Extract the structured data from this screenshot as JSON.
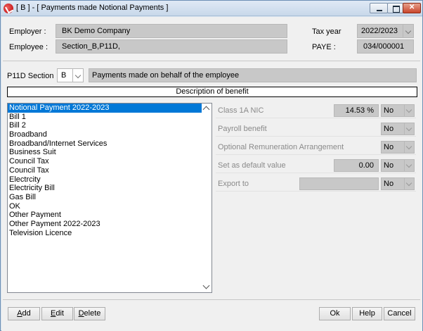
{
  "window": {
    "title": "[ B ] - [ Payments made Notional Payments ]"
  },
  "header": {
    "employer_label": "Employer :",
    "employer_value": "BK Demo Company",
    "employee_label": "Employee :",
    "employee_value": "Section_B,P11D,",
    "tax_year_label": "Tax year",
    "tax_year_value": "2022/2023",
    "paye_label": "PAYE :",
    "paye_value": "034/000001"
  },
  "section": {
    "label": "P11D Section",
    "value": "B",
    "description": "Payments made on behalf of the employee"
  },
  "description_header": "Description of benefit",
  "benefits": {
    "selected_index": 0,
    "items": [
      "Notional Payment 2022-2023",
      "Bill 1",
      "Bill 2",
      "Broadband",
      "Broadband/Internet Services",
      "Business Suit",
      "Council Tax",
      "Council Tax",
      "Electrcity",
      "Electricity Bill",
      "Gas Bill",
      "OK",
      "Other Payment",
      "Other Payment 2022-2023",
      "Television Licence"
    ]
  },
  "properties": {
    "class1a": {
      "label": "Class 1A NIC",
      "value": "14.53 %",
      "option": "No"
    },
    "payroll": {
      "label": "Payroll benefit",
      "option": "No"
    },
    "ora": {
      "label": "Optional Remuneration Arrangement",
      "option": "No"
    },
    "default": {
      "label": "Set as default value",
      "value": "0.00",
      "option": "No"
    },
    "export": {
      "label": "Export to",
      "value": "",
      "option": "No"
    }
  },
  "buttons": {
    "add_mn": "A",
    "add_rest": "dd",
    "edit_mn": "E",
    "edit_rest": "dit",
    "delete_mn": "D",
    "delete_rest": "elete",
    "ok": "Ok",
    "help": "Help",
    "cancel": "Cancel"
  }
}
